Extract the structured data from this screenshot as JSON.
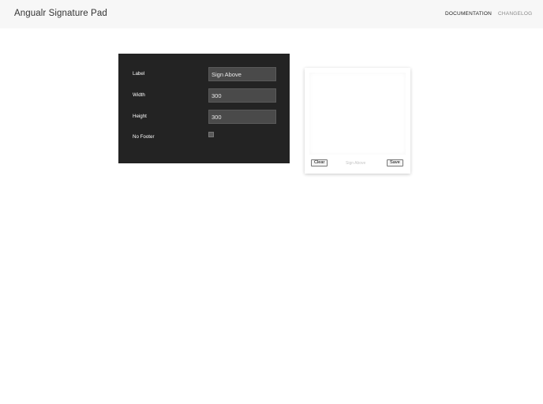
{
  "header": {
    "title": "Angualr Signature Pad",
    "nav": {
      "documentation": "DOCUMENTATION",
      "changelog": "CHANGELOG"
    }
  },
  "config": {
    "label": {
      "label": "Label",
      "value": "Sign Above"
    },
    "width": {
      "label": "Width",
      "value": "300"
    },
    "height": {
      "label": "Height",
      "value": "300"
    },
    "no_footer": {
      "label": "No Footer",
      "checked": false
    }
  },
  "signature_pad": {
    "clear_label": "Clear",
    "hint": "Sign Above",
    "save_label": "Save"
  }
}
